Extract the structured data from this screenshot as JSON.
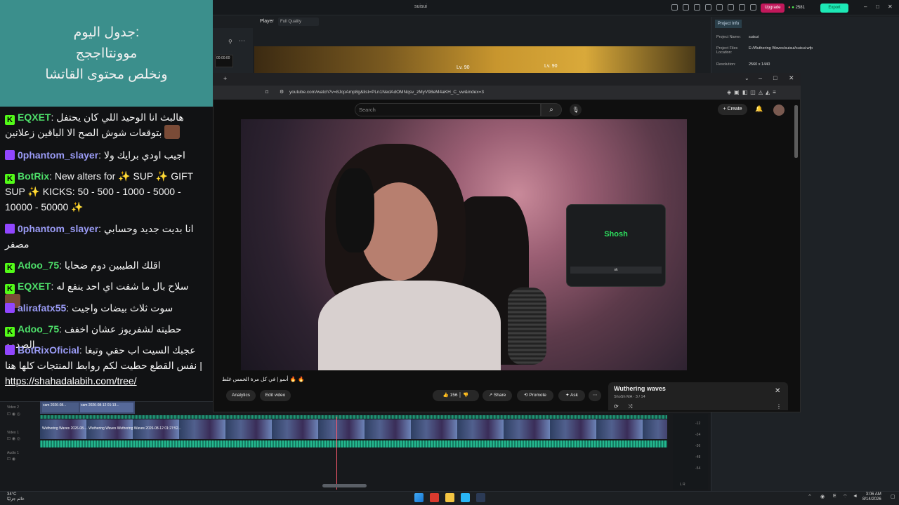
{
  "stream_overlay": {
    "schedule_lines": [
      "جدول اليوم:",
      "موونتااججج",
      "ونخلص محتوى القاتشا"
    ],
    "chat": [
      {
        "platform": "kick",
        "user": "EQXET",
        "text": "هالبث انا الوحيد اللي كان يحتفل بتوقعات شوش الصح الا الباقين زعلانين"
      },
      {
        "platform": "twitch",
        "user": "0phantom_slayer",
        "text": "اجيب اودي برايك ولا"
      },
      {
        "platform": "kick",
        "user": "BotRix",
        "text": "New alters for ✨ SUP ✨ GIFT SUP ✨ KICKS: 50 - 500 - 1000 - 5000 - 10000 - 50000 ✨"
      },
      {
        "platform": "twitch",
        "user": "0phantom_slayer",
        "text": "انا بديت جديد وحسابي مصفر"
      },
      {
        "platform": "kick",
        "user": "Adoo_75",
        "text": "اقلك الطيبين دوم ضحايا"
      },
      {
        "platform": "kick",
        "user": "EQXET",
        "text": "سلاح بال ما شفت اي احد ينفع له"
      },
      {
        "platform": "twitch",
        "user": "alirafatx55",
        "text": "سوت ثلاث بيضات واجيت"
      },
      {
        "platform": "kick",
        "user": "Adoo_75",
        "text": "حطيته لشفريوز عشان اخفف الصدمه"
      },
      {
        "platform": "twitch",
        "user": "BotRixOficial",
        "text": "عجبك السيت اب حقي وتبغا نفس القطع حطيت لكم روابط المنتجات كلها هنا |",
        "link": "https://shahadalabih.com/tree/"
      }
    ]
  },
  "editor": {
    "window_title": "suisui",
    "upgrade_label": "Upgrade",
    "credits": "2581",
    "export_label": "Export",
    "player_label": "Player",
    "quality": "Full Quality",
    "preview_levels": [
      "Lv. 90",
      "Lv. 90"
    ],
    "thumb_time": "00:00:00",
    "project_tab": "Project Info",
    "project_info": [
      {
        "key": "Project Name:",
        "value": "suisui"
      },
      {
        "key": "Project Files Location:",
        "value": "E:/Wuthering Waves/suisui/suisui.wfp"
      },
      {
        "key": "Resolution:",
        "value": "2560 x 1440"
      }
    ],
    "track_labels": [
      "Video 2",
      "Video 1",
      "Audio 1"
    ],
    "clip_labels": [
      "cam 2026-08...",
      "cam 2026-08-12 01:13..."
    ],
    "video_track_text": "Wuthering Waves 2026-08-...  Wuthering Waves  Wuthering Waves 2026-08-12 01:27:52...",
    "meter_db": [
      "-12",
      "-24",
      "-36",
      "-48",
      "-54"
    ],
    "meter_lr": "L  R"
  },
  "youtube": {
    "url": "youtube.com/watch?v=8JcpAmp8g&list=PLn1NedAdOMNqsv_zMyV98eM4aKH_C_vw&index=3",
    "search_placeholder": "Search",
    "create_label": "Create",
    "overlay_name": "Shosh",
    "overlay_ok": "ok",
    "caption": "أسو | في كل مرة الخمس غلط 🔥 🔥",
    "likes": "156",
    "share": "Share",
    "promote": "Promote",
    "ask": "Ask",
    "analytics": "Analytics",
    "edit_video": "Edit video",
    "playlist_title": "Wuthering waves",
    "playlist_sub": "ShoSh MA · 3 / 14"
  },
  "taskbar": {
    "weather_temp": "34°C",
    "weather_text": "غائم جزئيًا",
    "time": "3:06 AM",
    "date": "8/14/2026",
    "lang": "E"
  }
}
